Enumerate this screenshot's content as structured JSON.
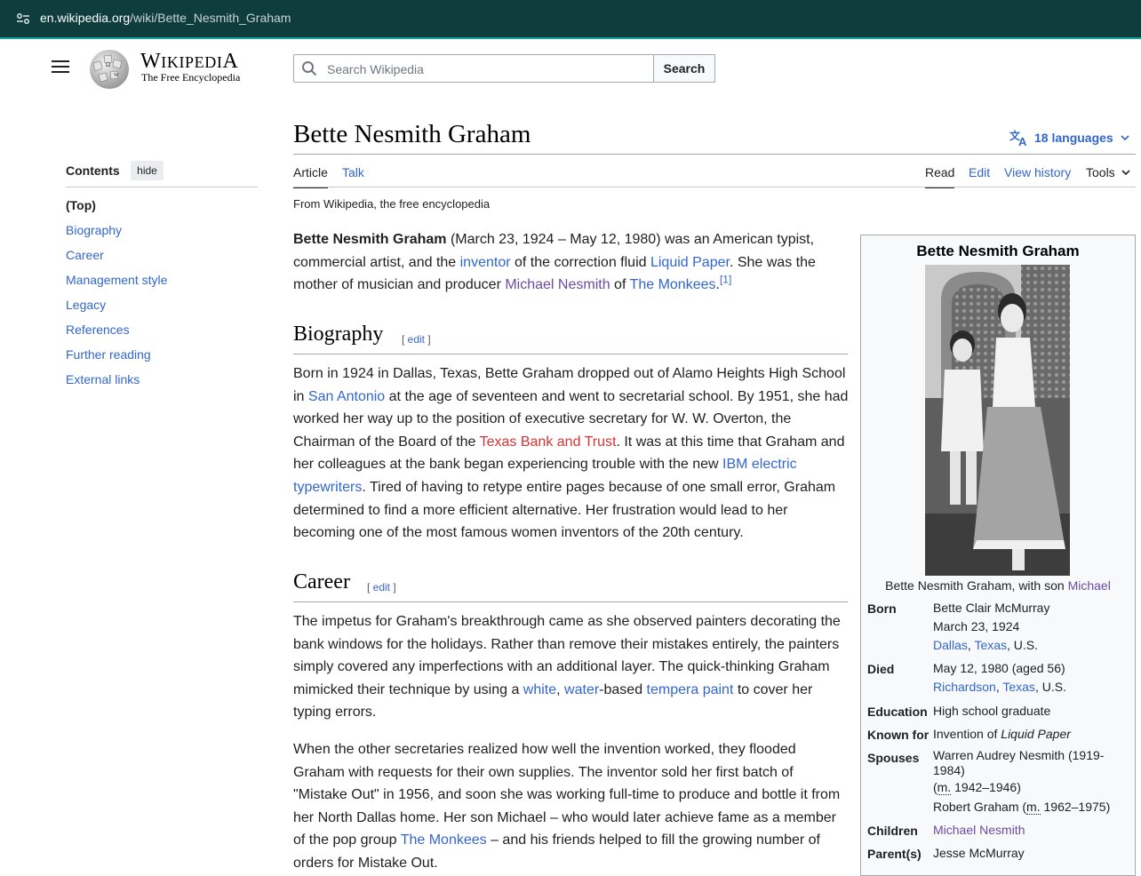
{
  "browser": {
    "url_host": "en.wikipedia.org",
    "url_path": "/wiki/Bette_Nesmith_Graham"
  },
  "header": {
    "wordmark": "Wikipedia",
    "tagline": "The Free Encyclopedia",
    "search_placeholder": "Search Wikipedia",
    "search_button": "Search"
  },
  "page": {
    "title": "Bette Nesmith Graham",
    "languages": "18 languages",
    "from": "From Wikipedia, the free encyclopedia"
  },
  "tabs": {
    "article": "Article",
    "talk": "Talk",
    "read": "Read",
    "edit": "Edit",
    "history": "View history",
    "tools": "Tools"
  },
  "toc": {
    "title": "Contents",
    "hide": "hide",
    "items": [
      "(Top)",
      "Biography",
      "Career",
      "Management style",
      "Legacy",
      "References",
      "Further reading",
      "External links"
    ]
  },
  "sections": {
    "biography": "Biography",
    "career": "Career",
    "edit": "edit"
  },
  "lead": {
    "name": "Bette Nesmith Graham",
    "t1": " (March 23, 1924 – May 12, 1980) was an American typist, commercial artist, and the ",
    "l1": "inventor",
    "t2": " of the correction fluid ",
    "l2": "Liquid Paper",
    "t3": ". She was the mother of musician and producer ",
    "l3": "Michael Nesmith",
    "t4": " of ",
    "l4": "The Monkees",
    "t5": ".",
    "ref": "[1]"
  },
  "biography": {
    "t1": "Born in 1924 in Dallas, Texas, Bette Graham dropped out of Alamo Heights High School in ",
    "l1": "San Antonio",
    "t2": " at the age of seventeen and went to secretarial school. By 1951, she had worked her way up to the position of executive secretary for W. W. Overton, the Chairman of the Board of the ",
    "l2": "Texas Bank and Trust",
    "t3": ". It was at this time that Graham and her colleagues at the bank began experiencing trouble with the new ",
    "l3": "IBM electric typewriters",
    "t4": ". Tired of having to retype entire pages because of one small error, Graham determined to find a more efficient alternative. Her frustration would lead to her becoming one of the most famous women inventors of the 20th century."
  },
  "career": {
    "p1_t1": "The impetus for Graham's breakthrough came as she observed painters decorating the bank windows for the holidays. Rather than remove their mistakes entirely, the painters simply covered any imperfections with an additional layer. The quick-thinking Graham mimicked their technique by using a ",
    "p1_l1": "white",
    "p1_t2": ", ",
    "p1_l2": "water",
    "p1_t3": "-based ",
    "p1_l3": "tempera paint",
    "p1_t4": " to cover her typing errors.",
    "p2_t1": "When the other secretaries realized how well the invention worked, they flooded Graham with requests for their own supplies. The inventor sold her first batch of \"Mistake Out\" in 1956, and soon she was working full-time to produce and bottle it from her North Dallas home. Her son Michael – who would later achieve fame as a member of the pop group ",
    "p2_l1": "The Monkees",
    "p2_t2": " – and his friends helped to fill the growing number of orders for Mistake Out."
  },
  "infobox": {
    "title": "Bette Nesmith Graham",
    "caption_t": "Bette Nesmith Graham, with son ",
    "caption_l": "Michael",
    "born_label": "Born",
    "born_name": "Bette Clair McMurray",
    "born_date": "March 23, 1924",
    "born_city": "Dallas",
    "born_state": "Texas",
    "born_country": ", U.S.",
    "died_label": "Died",
    "died_date": "May 12, 1980 (aged 56)",
    "died_city": "Richardson",
    "died_state": "Texas",
    "died_country": ", U.S.",
    "education_label": "Education",
    "education": "High school graduate",
    "known_label": "Known for",
    "known_t": "Invention of ",
    "known_i": "Liquid Paper",
    "spouses_label": "Spouses",
    "spouse1": "Warren Audrey Nesmith (1919-1984)",
    "spouse1_m": "m.",
    "spouse1_years": " 1942–1946)",
    "spouse2": "Robert Graham (",
    "spouse2_m": "m.",
    "spouse2_years": " 1962–1975)",
    "children_label": "Children",
    "children": "Michael Nesmith",
    "parents_label": "Parent(s)",
    "parents": "Jesse McMurray"
  },
  "colors": {
    "link": "#3366cc",
    "visited": "#6b4ba1",
    "redlink": "#d73333",
    "browserbar": "#0f3d3e"
  },
  "icons": [
    "site-settings-icon",
    "menu-icon",
    "wikipedia-globe-logo",
    "search-icon",
    "language-icon",
    "chevron-down-icon"
  ]
}
